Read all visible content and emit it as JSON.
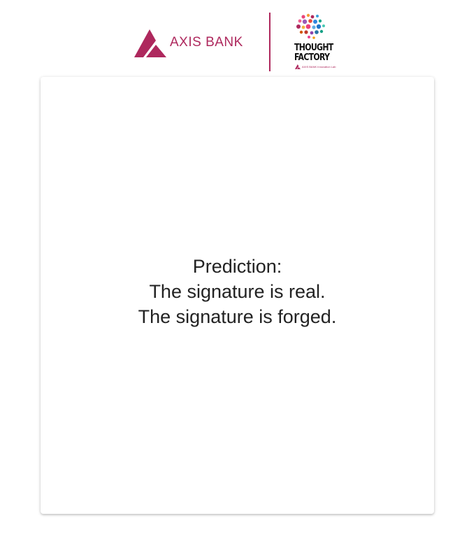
{
  "header": {
    "bank_logo_text": "AXIS BANK",
    "lab_logo_line1": "THOUGHT",
    "lab_logo_line2": "FACTORY",
    "lab_logo_subtext": "AXIS BANK Innovation Lab"
  },
  "result": {
    "label": "Prediction:",
    "line1": "The signature is real.",
    "line2": "The signature is forged."
  },
  "colors": {
    "brand": "#ae285d",
    "text": "#222222",
    "background": "#ffffff"
  }
}
